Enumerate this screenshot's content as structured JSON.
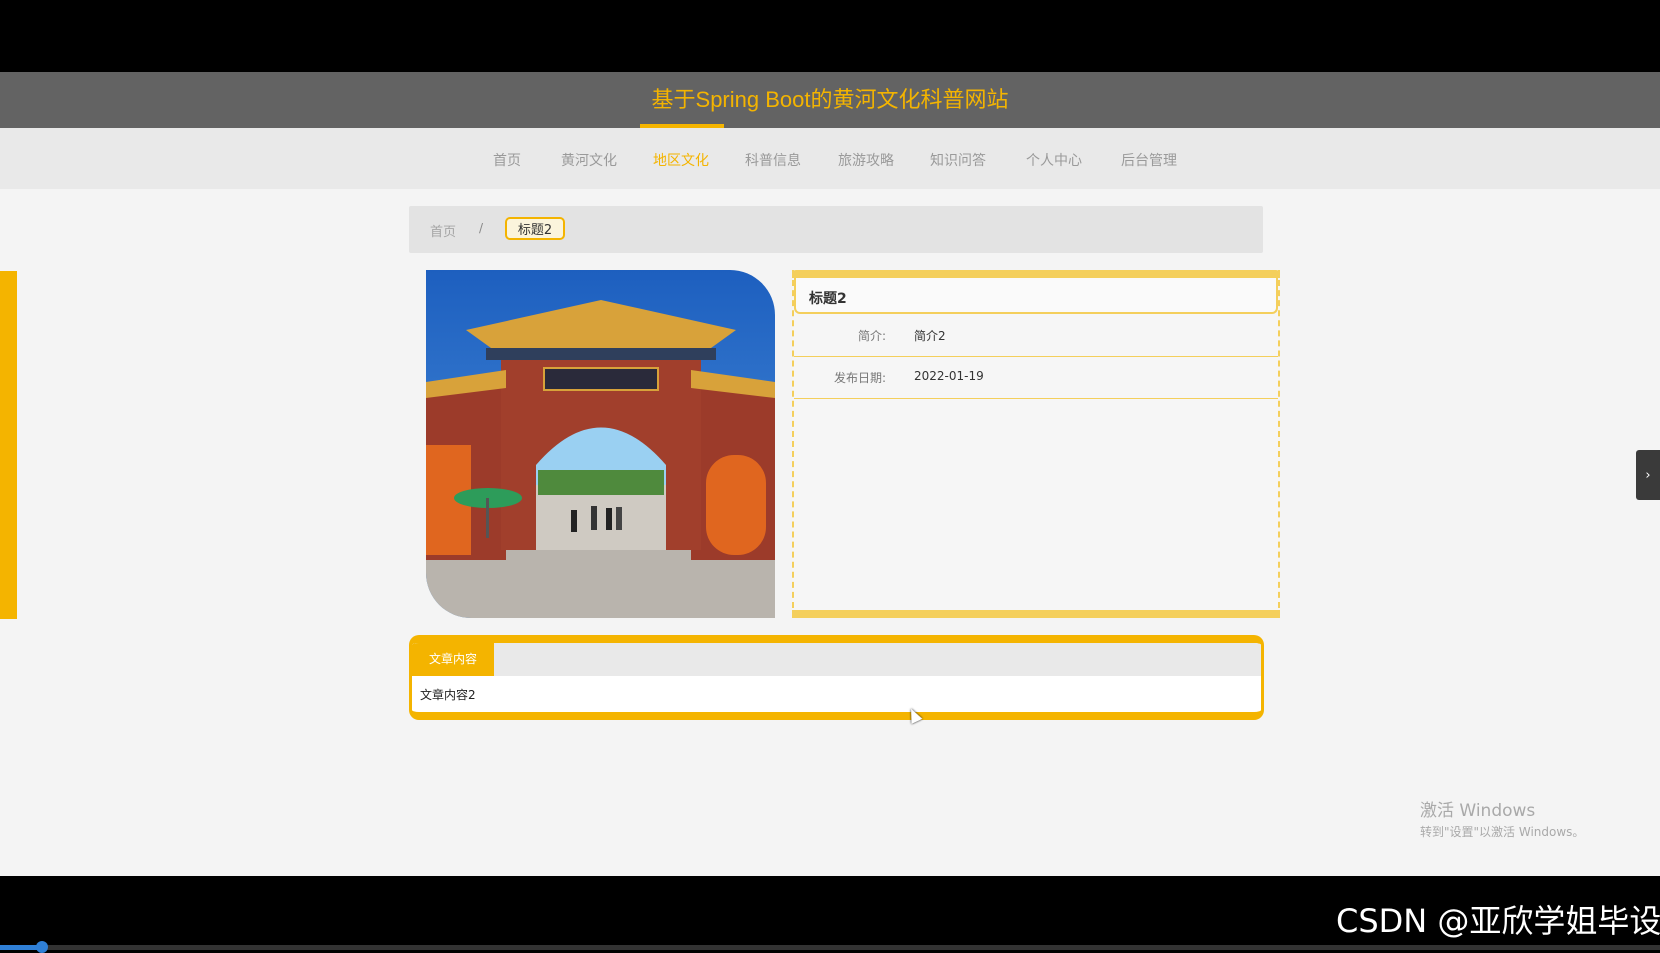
{
  "site": {
    "title": "基于Spring Boot的黄河文化科普网站"
  },
  "nav": {
    "items": [
      "首页",
      "黄河文化",
      "地区文化",
      "科普信息",
      "旅游攻略",
      "知识问答",
      "个人中心",
      "后台管理"
    ],
    "active_index": 2
  },
  "breadcrumb": {
    "home": "首页",
    "separator": "/",
    "current": "标题2"
  },
  "detail": {
    "title": "标题2",
    "rows": [
      {
        "label": "简介:",
        "value": "简介2"
      },
      {
        "label": "发布日期:",
        "value": "2022-01-19"
      }
    ]
  },
  "content": {
    "tab_label": "文章内容",
    "text": "文章内容2"
  },
  "right_toggle": {
    "icon": "chevron-right-icon",
    "glyph": "›"
  },
  "watermark": {
    "line1": "激活 Windows",
    "line2": "转到\"设置\"以激活 Windows。"
  },
  "csdn": {
    "text": "CSDN @亚欣学姐毕设"
  },
  "colors": {
    "accent": "#f4b400",
    "header_bg": "#636363",
    "nav_bg": "#e9e9e9"
  }
}
